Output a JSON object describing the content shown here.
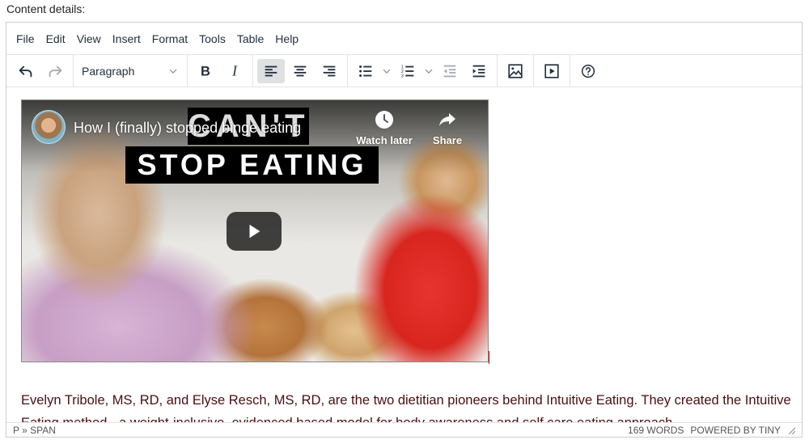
{
  "field_label": "Content details:",
  "menubar": {
    "items": [
      "File",
      "Edit",
      "View",
      "Insert",
      "Format",
      "Tools",
      "Table",
      "Help"
    ]
  },
  "toolbar": {
    "undo": "undo-icon",
    "redo": "redo-icon",
    "block_format": {
      "selected": "Paragraph"
    },
    "bold": "bold-icon",
    "italic": "italic-icon",
    "align_left_active": true,
    "align_left": "align-left-icon",
    "align_center": "align-center-icon",
    "align_right": "align-right-icon",
    "bullet_list": "bullet-list-icon",
    "numbered_list": "numbered-list-icon",
    "outdent": "outdent-icon",
    "indent": "indent-icon",
    "image": "image-icon",
    "media": "media-icon",
    "help": "help-icon"
  },
  "content": {
    "video": {
      "title": "How I (finally) stopped binge eating",
      "thumbnail_text_1": "CAN'T",
      "thumbnail_text_2": "STOP EATING",
      "watch_later": "Watch later",
      "share": "Share"
    },
    "paragraph": "Evelyn Tribole, MS, RD, and Elyse Resch, MS, RD, are the two dietitian pioneers behind Intuitive Eating. They created the Intuitive Eating method - a weight-inclusive, evidenced based model for body awareness and self care eating approach."
  },
  "statusbar": {
    "path": "P » SPAN",
    "word_count": "169 WORDS",
    "branding": "POWERED BY TINY"
  },
  "colors": {
    "text_color": "#4a0e0e",
    "active_button_bg": "#dee0e2",
    "ui_text": "#222f3e"
  }
}
